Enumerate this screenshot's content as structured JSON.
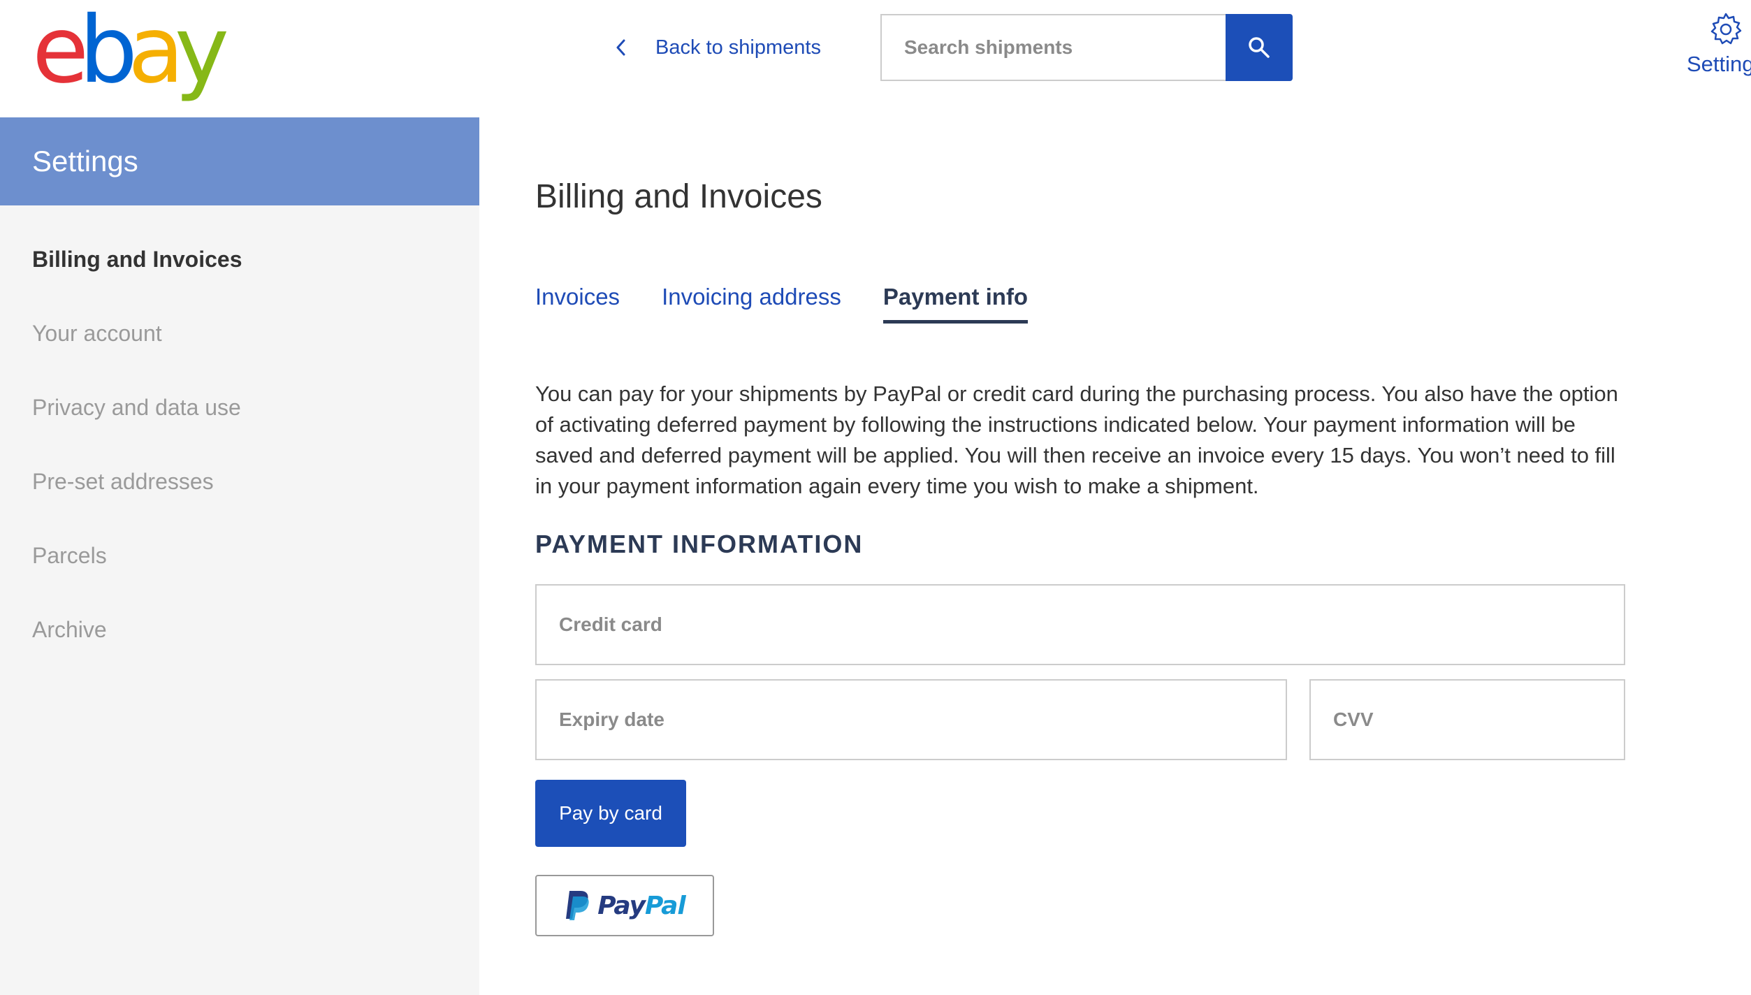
{
  "header": {
    "logo_letters": [
      "e",
      "b",
      "a",
      "y"
    ],
    "back_label": "Back to shipments",
    "search_placeholder": "Search shipments",
    "settings_label": "Settings"
  },
  "sidebar": {
    "title": "Settings",
    "items": [
      {
        "label": "Billing and Invoices",
        "active": true
      },
      {
        "label": "Your account",
        "active": false
      },
      {
        "label": "Privacy and data use",
        "active": false
      },
      {
        "label": "Pre-set addresses",
        "active": false
      },
      {
        "label": "Parcels",
        "active": false
      },
      {
        "label": "Archive",
        "active": false
      }
    ]
  },
  "main": {
    "title": "Billing and Invoices",
    "tabs": [
      {
        "label": "Invoices",
        "active": false
      },
      {
        "label": "Invoicing address",
        "active": false
      },
      {
        "label": "Payment info",
        "active": true
      }
    ],
    "description": "You can pay for your shipments by PayPal or credit card during the purchasing process. You also have the option of activating deferred payment by following the instructions indicated below. Your payment information will be saved and deferred payment will be applied. You will then receive an invoice every 15 days. You won’t need to fill in your payment information again every time you wish to make a shipment.",
    "section_heading": "PAYMENT INFORMATION",
    "fields": {
      "card_placeholder": "Credit card",
      "expiry_placeholder": "Expiry date",
      "cvv_placeholder": "CVV"
    },
    "pay_card_label": "Pay by card",
    "paypal": {
      "part1": "Pay",
      "part2": "Pal"
    }
  },
  "colors": {
    "accent_blue": "#1c4fb8",
    "sidebar_header": "#6d8fce",
    "link_blue": "#1e4bb6",
    "heading_navy": "#2c3a55"
  },
  "icons": [
    "chevron-left-icon",
    "search-icon",
    "gear-icon",
    "paypal-logo-icon"
  ]
}
